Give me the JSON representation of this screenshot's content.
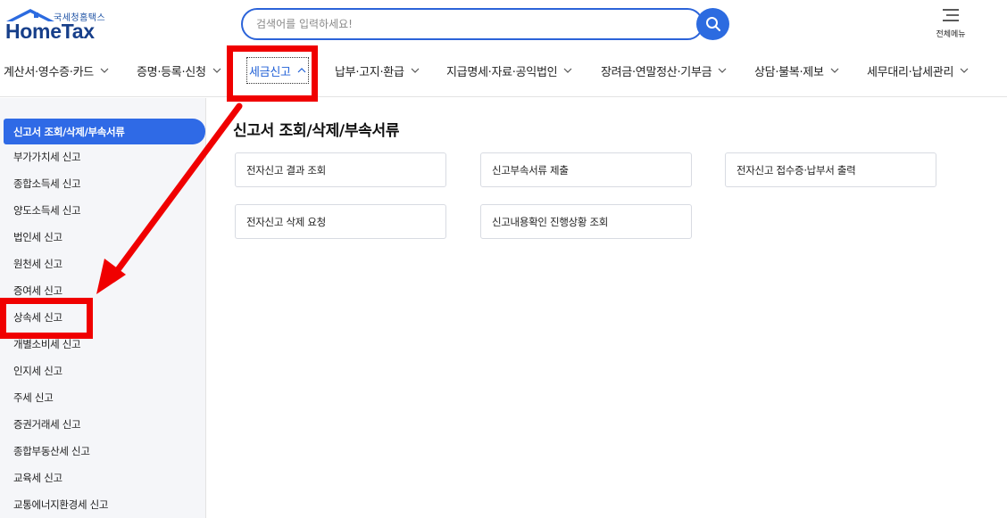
{
  "header": {
    "logo_small": "국세청홈택스",
    "logo_main": "HomeTax",
    "search_placeholder": "검색어를 입력하세요!",
    "allmenu_label": "전체메뉴"
  },
  "gnb": [
    {
      "label": "계산서·영수증·카드",
      "active": false
    },
    {
      "label": "증명·등록·신청",
      "active": false
    },
    {
      "label": "세금신고",
      "active": true
    },
    {
      "label": "납부·고지·환급",
      "active": false
    },
    {
      "label": "지급명세·자료·공익법인",
      "active": false
    },
    {
      "label": "장려금·연말정산·기부금",
      "active": false
    },
    {
      "label": "상담·불복·제보",
      "active": false
    },
    {
      "label": "세무대리·납세관리",
      "active": false
    }
  ],
  "sidebar": {
    "items": [
      {
        "label": "신고서 조회/삭제/부속서류",
        "active": true
      },
      {
        "label": "부가가치세 신고"
      },
      {
        "label": "종합소득세 신고"
      },
      {
        "label": "양도소득세 신고"
      },
      {
        "label": "법인세 신고"
      },
      {
        "label": "원천세 신고"
      },
      {
        "label": "증여세 신고"
      },
      {
        "label": "상속세 신고"
      },
      {
        "label": "개별소비세 신고"
      },
      {
        "label": "인지세 신고"
      },
      {
        "label": "주세 신고"
      },
      {
        "label": "증권거래세 신고"
      },
      {
        "label": "종합부동산세 신고"
      },
      {
        "label": "교육세 신고"
      },
      {
        "label": "교통에너지환경세 신고"
      }
    ]
  },
  "main": {
    "title": "신고서 조회/삭제/부속서류",
    "cards": [
      {
        "label": "전자신고 결과 조회"
      },
      {
        "label": "신고부속서류 제출"
      },
      {
        "label": "전자신고 접수증·납부서 출력"
      },
      {
        "label": "전자신고 삭제 요청"
      },
      {
        "label": "신고내용확인 진행상황 조회"
      }
    ]
  },
  "colors": {
    "brand_blue": "#2c6be0",
    "logo_navy": "#173f8a",
    "annotation_red": "#f00000",
    "sidebar_bg": "#f5f6f9"
  },
  "icons": {
    "search": "search-icon",
    "menu": "hamburger-icon",
    "dropdown": "chevron-down-icon",
    "dropup": "chevron-up-icon",
    "logo": "house-roof-icon"
  }
}
